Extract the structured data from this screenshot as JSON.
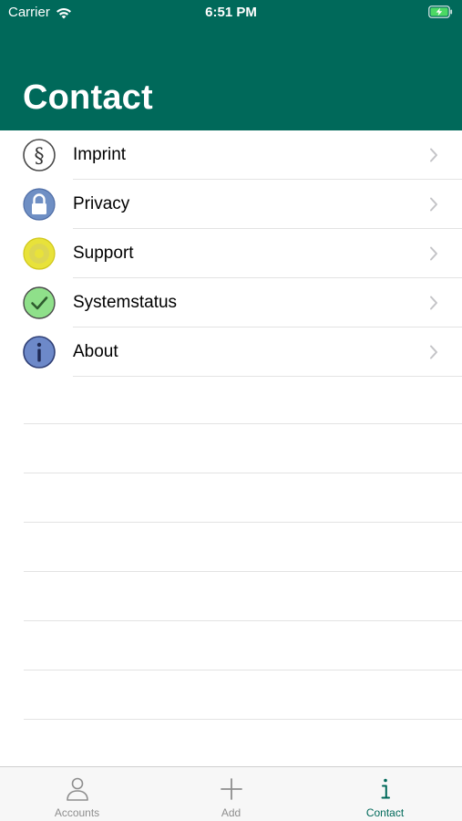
{
  "status_bar": {
    "carrier": "Carrier",
    "time": "6:51 PM"
  },
  "header": {
    "title": "Contact",
    "background_color": "#00695a"
  },
  "list": {
    "items": [
      {
        "label": "Imprint",
        "icon": "section-sign-icon"
      },
      {
        "label": "Privacy",
        "icon": "lock-icon"
      },
      {
        "label": "Support",
        "icon": "support-icon"
      },
      {
        "label": "Systemstatus",
        "icon": "checkmark-icon"
      },
      {
        "label": "About",
        "icon": "info-icon"
      }
    ]
  },
  "tab_bar": {
    "tabs": [
      {
        "label": "Accounts",
        "icon": "person-icon",
        "active": false
      },
      {
        "label": "Add",
        "icon": "plus-icon",
        "active": false
      },
      {
        "label": "Contact",
        "icon": "info-icon",
        "active": true
      }
    ],
    "active_color": "#00695a",
    "inactive_color": "#8e8e8e"
  }
}
